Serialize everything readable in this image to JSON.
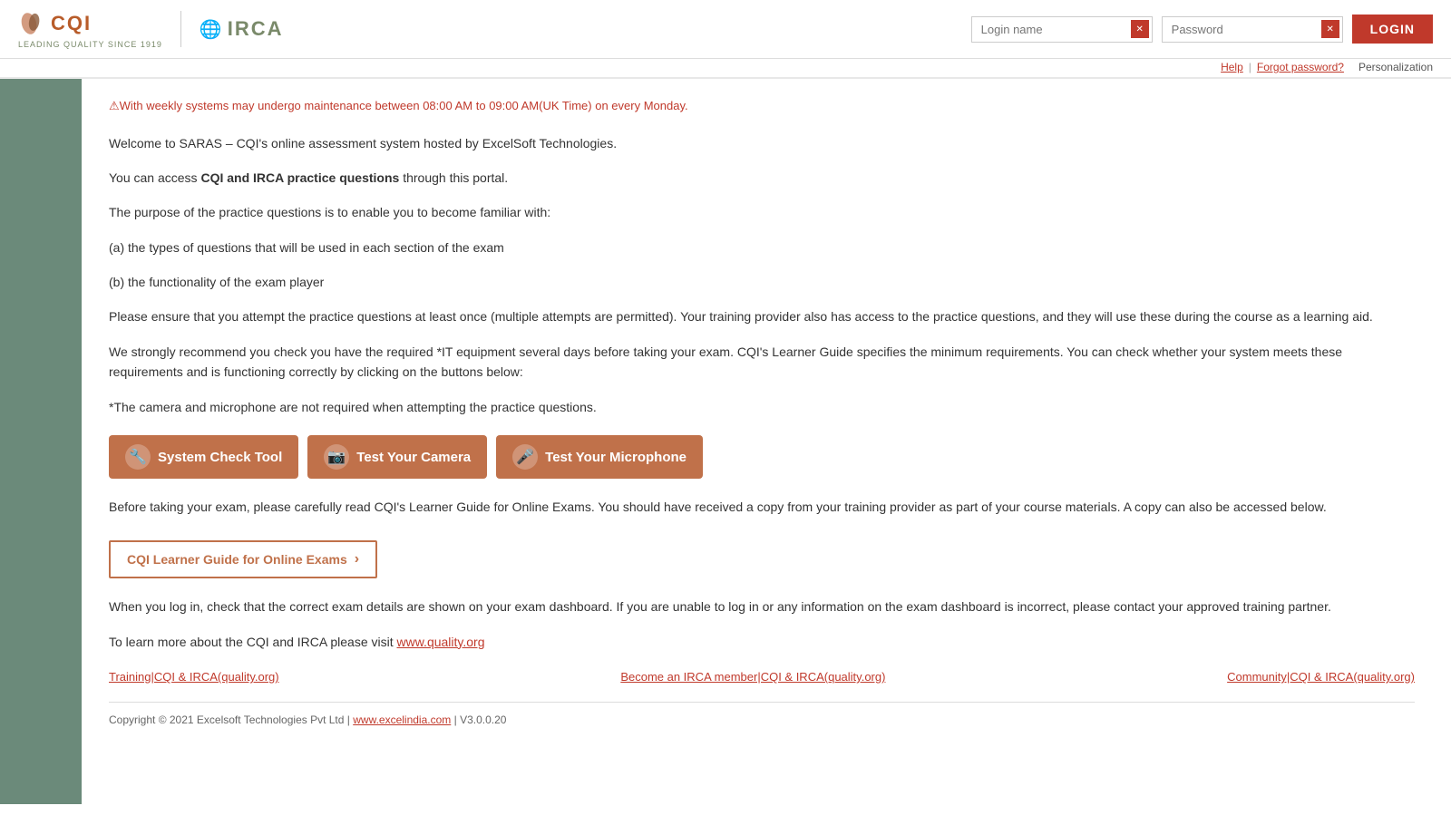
{
  "header": {
    "cqi_text": "CQI",
    "irca_text": "IRCA",
    "tagline": "LEADING QUALITY SINCE 1919",
    "login_name_placeholder": "Login name",
    "password_placeholder": "Password",
    "login_button": "LOGIN",
    "help_link": "Help",
    "forgot_password_link": "Forgot password?",
    "personalization_link": "Personalization"
  },
  "warning": {
    "text": "⚠With weekly systems may undergo maintenance between 08:00 AM to 09:00 AM(UK Time) on every Monday."
  },
  "main": {
    "para1": "Welcome to SARAS – CQI's online assessment system hosted by ExcelSoft Technologies.",
    "para2_start": "You can access ",
    "para2_bold": "CQI and IRCA practice questions",
    "para2_end": " through this portal.",
    "para3": "The purpose of the practice questions is to enable you to become familiar with:",
    "para4a": "(a) the types of questions that will be used in each section of the exam",
    "para4b": "(b) the functionality of the exam player",
    "para5": "Please ensure that you attempt the practice questions at least once (multiple attempts are permitted). Your training provider also has access to the practice questions, and they will use these during the course as a learning aid.",
    "para6": "We strongly recommend you check you have the required *IT equipment several days before taking your exam. CQI's Learner Guide specifies the minimum requirements. You can check whether your system meets these requirements and is functioning correctly by clicking on the buttons below:",
    "para7": "*The camera and microphone are not required when attempting the practice questions.",
    "buttons": {
      "system_check": "System Check Tool",
      "camera": "Test Your Camera",
      "microphone": "Test Your Microphone"
    },
    "para8_start": "Before taking your exam, please carefully read CQI's Learner Guide for Online Exams. You should have received a copy from your training provider as part of your course materials. A copy can also be accessed below.",
    "guide_btn": "CQI Learner Guide for Online Exams",
    "para9": "When you log in, check that the correct exam details are shown on your exam dashboard. If you are unable to log in or any information on the exam dashboard is incorrect, please contact your approved training partner.",
    "para10_start": "To learn more about the CQI and IRCA please visit ",
    "para10_link": "www.quality.org",
    "footer_links": [
      "Training|CQI & IRCA(quality.org)",
      "Become an IRCA member|CQI & IRCA(quality.org)",
      "Community|CQI & IRCA(quality.org)"
    ],
    "copyright": "Copyright © 2021 Excelsoft Technologies Pvt Ltd | ",
    "copyright_link": "www.excelindia.com",
    "copyright_version": " | V3.0.0.20"
  },
  "colors": {
    "brand_red": "#c0392b",
    "brand_orange": "#c0714a",
    "brand_green": "#6b8a7a"
  }
}
